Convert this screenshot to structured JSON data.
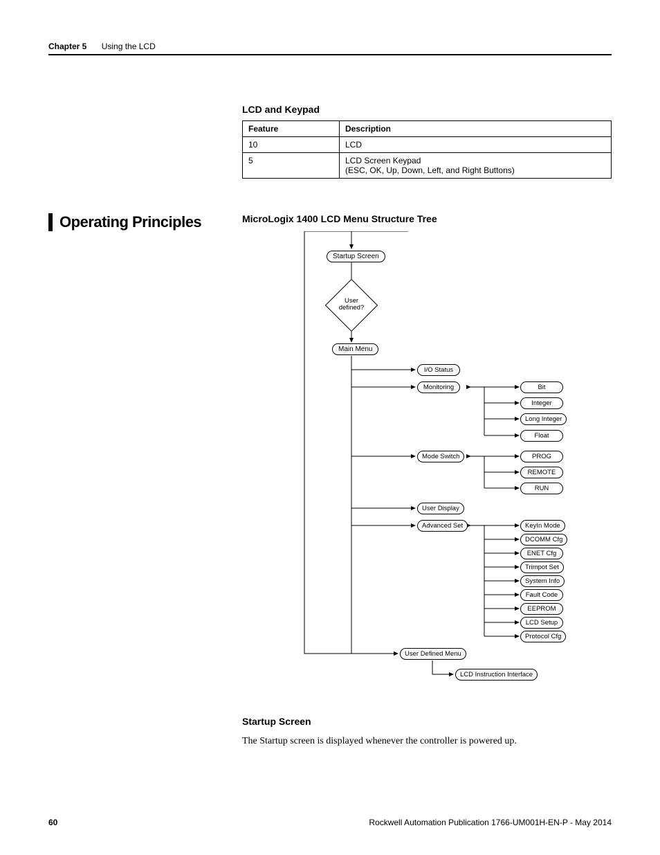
{
  "header": {
    "chapter": "Chapter 5",
    "title": "Using the LCD"
  },
  "table": {
    "title": "LCD and Keypad",
    "headers": {
      "c1": "Feature",
      "c2": "Description"
    },
    "rows": [
      {
        "c1": "10",
        "c2": "LCD"
      },
      {
        "c1": "5",
        "c2": "LCD Screen Keypad\n(ESC, OK, Up, Down, Left, and Right Buttons)"
      }
    ]
  },
  "side_heading": "Operating Principles",
  "diagram_title": "MicroLogix 1400 LCD Menu Structure Tree",
  "nodes": {
    "startup": "Startup Screen",
    "user_defined_q": "User\ndefined?",
    "main_menu": "Main Menu",
    "io_status": "I/O Status",
    "monitoring": "Monitoring",
    "bit": "Bit",
    "integer": "Integer",
    "long_integer": "Long Integer",
    "float": "Float",
    "mode_switch": "Mode Switch",
    "prog": "PROG",
    "remote": "REMOTE",
    "run": "RUN",
    "user_display": "User Display",
    "advanced_set": "Advanced Set",
    "keyin": "KeyIn Mode",
    "dcomm": "DCOMM Cfg",
    "enet": "ENET Cfg",
    "trimpot": "Trimpot Set",
    "sysinfo": "System Info",
    "fault": "Fault Code",
    "eeprom": "EEPROM",
    "lcdsetup": "LCD Setup",
    "protocol": "Protocol Cfg",
    "userdef": "User Defined Menu",
    "lcdinstr": "LCD Instruction Interface"
  },
  "startup_section": {
    "heading": "Startup Screen",
    "body": "The Startup screen is displayed whenever the controller is powered up."
  },
  "footer": {
    "page": "60",
    "pub": "Rockwell Automation Publication 1766-UM001H-EN-P - May 2014"
  }
}
